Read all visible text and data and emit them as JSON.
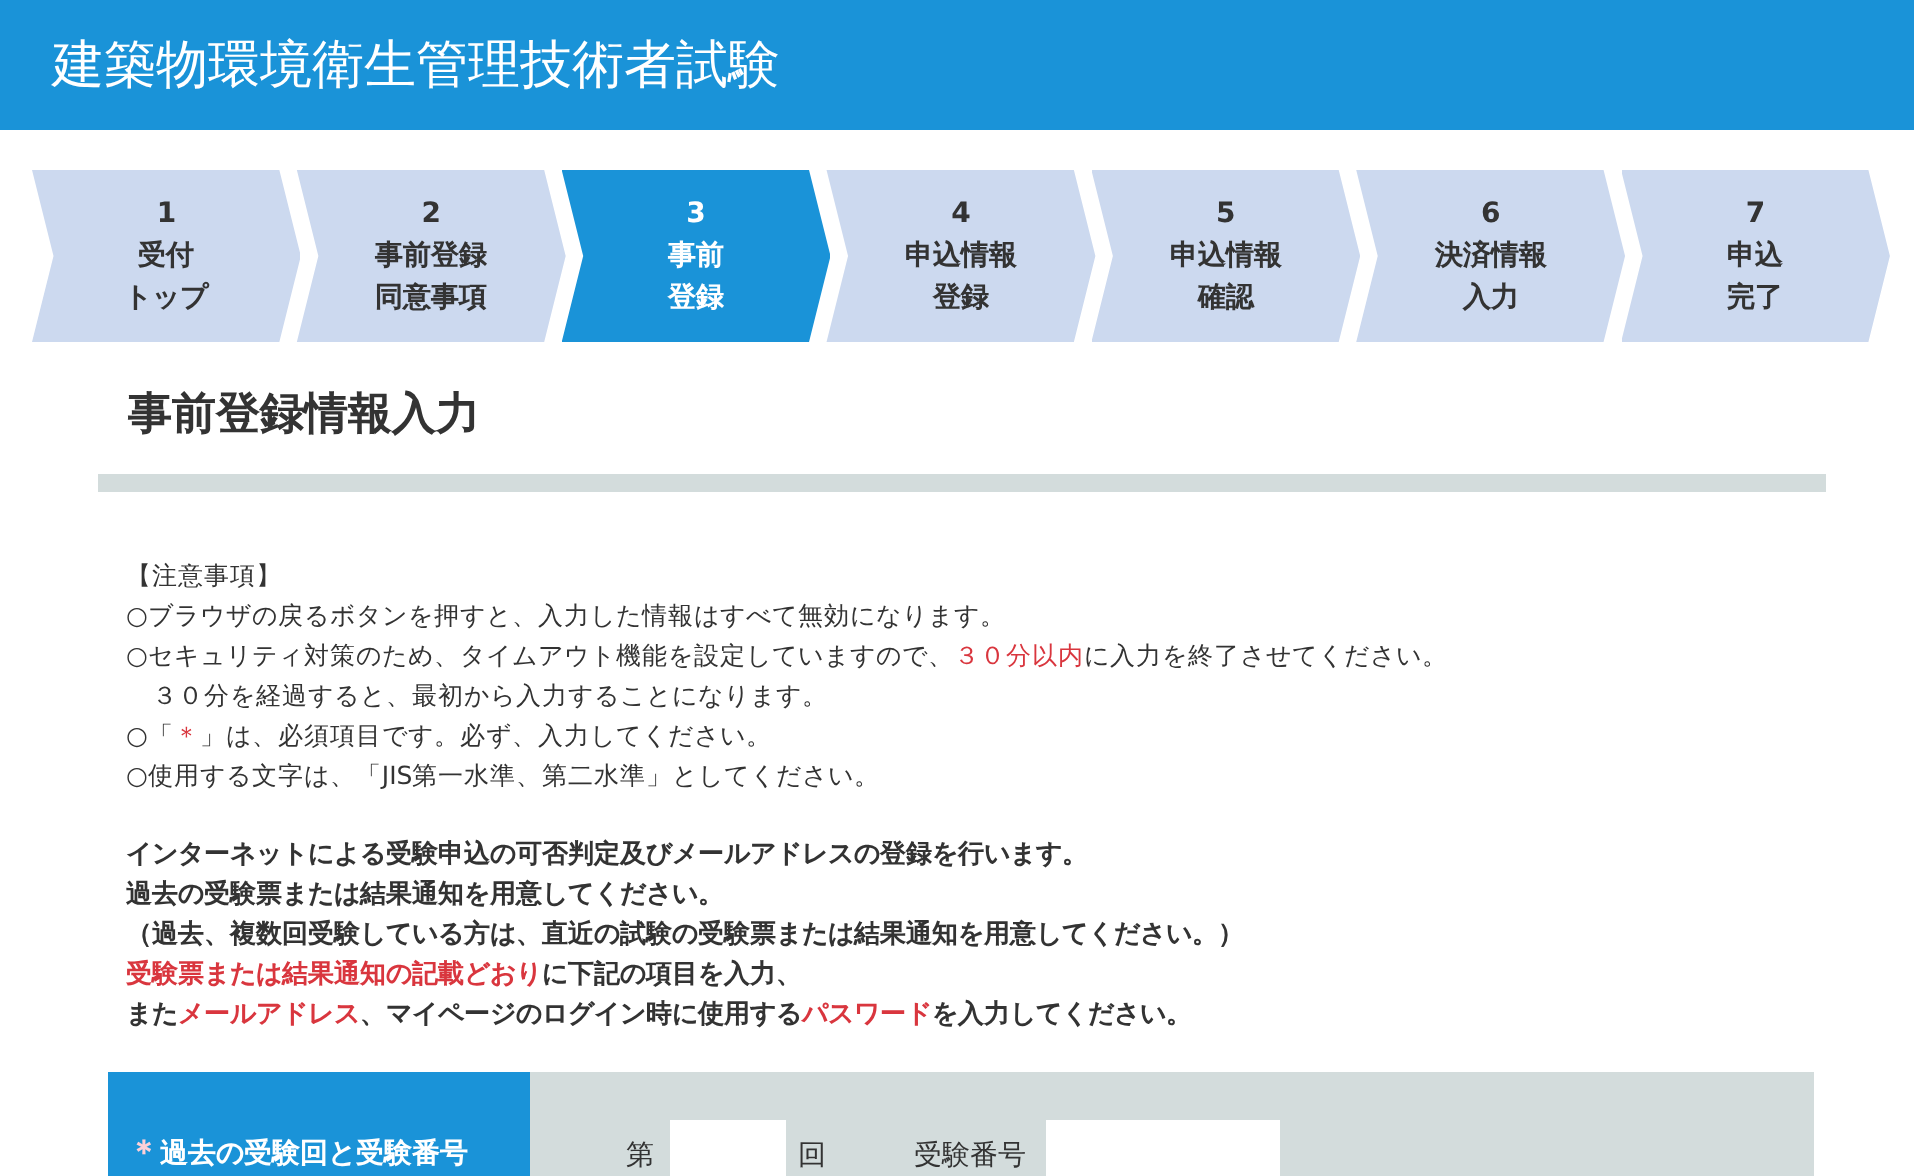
{
  "header": {
    "title": "建築物環境衛生管理技術者試験"
  },
  "steps": [
    {
      "number": "1",
      "label": [
        "受付",
        "トップ"
      ],
      "selected": false
    },
    {
      "number": "2",
      "label": [
        "事前登録",
        "同意事項"
      ],
      "selected": false
    },
    {
      "number": "3",
      "label": [
        "事前",
        "登録"
      ],
      "selected": true
    },
    {
      "number": "4",
      "label": [
        "申込情報",
        "登録"
      ],
      "selected": false
    },
    {
      "number": "5",
      "label": [
        "申込情報",
        "確認"
      ],
      "selected": false
    },
    {
      "number": "6",
      "label": [
        "決済情報",
        "入力"
      ],
      "selected": false
    },
    {
      "number": "7",
      "label": [
        "申込",
        "完了"
      ],
      "selected": false
    }
  ],
  "page_title": "事前登録情報入力",
  "notes": [
    [
      {
        "text": "【注意事項】",
        "emphasis": false
      }
    ],
    [
      {
        "text": "○ブラウザの戻るボタンを押すと、入力した情報はすべて無効になります。",
        "emphasis": false
      }
    ],
    [
      {
        "text": "○セキュリティ対策のため、タイムアウト機能を設定していますので、",
        "emphasis": false
      },
      {
        "text": "３０分以内",
        "emphasis": true
      },
      {
        "text": "に入力を終了させてください。",
        "emphasis": false
      }
    ],
    [
      {
        "text": "　３０分を経過すると、最初から入力することになります。",
        "emphasis": false
      }
    ],
    [
      {
        "text": "○「",
        "emphasis": false
      },
      {
        "text": "＊",
        "emphasis": true
      },
      {
        "text": "」は、必須項目です。必ず、入力してください。",
        "emphasis": false
      }
    ],
    [
      {
        "text": "○使用する文字は、「JIS第一水準、第二水準」としてください。",
        "emphasis": false
      }
    ]
  ],
  "instructions": [
    [
      {
        "text": "インターネットによる受験申込の可否判定及びメールアドレスの登録を行います。",
        "emphasis": false
      }
    ],
    [
      {
        "text": "過去の受験票または結果通知を用意してください。",
        "emphasis": false
      }
    ],
    [
      {
        "text": "（過去、複数回受験している方は、直近の試験の受験票または結果通知を用意してください。）",
        "emphasis": false
      }
    ],
    [
      {
        "text": "受験票または結果通知の記載どおり",
        "emphasis": true
      },
      {
        "text": "に下記の項目を入力、",
        "emphasis": false
      }
    ],
    [
      {
        "text": "また",
        "emphasis": false
      },
      {
        "text": "メールアドレス",
        "emphasis": true
      },
      {
        "text": "、マイページのログイン時に使用する",
        "emphasis": false
      },
      {
        "text": "パスワード",
        "emphasis": true
      },
      {
        "text": "を入力してください。",
        "emphasis": false
      }
    ]
  ],
  "form": {
    "rows": [
      {
        "required_mark": "＊",
        "label": "過去の受験回と受験番号",
        "prefix": "第",
        "suffix": "回",
        "number_label": "受験番号"
      }
    ]
  }
}
